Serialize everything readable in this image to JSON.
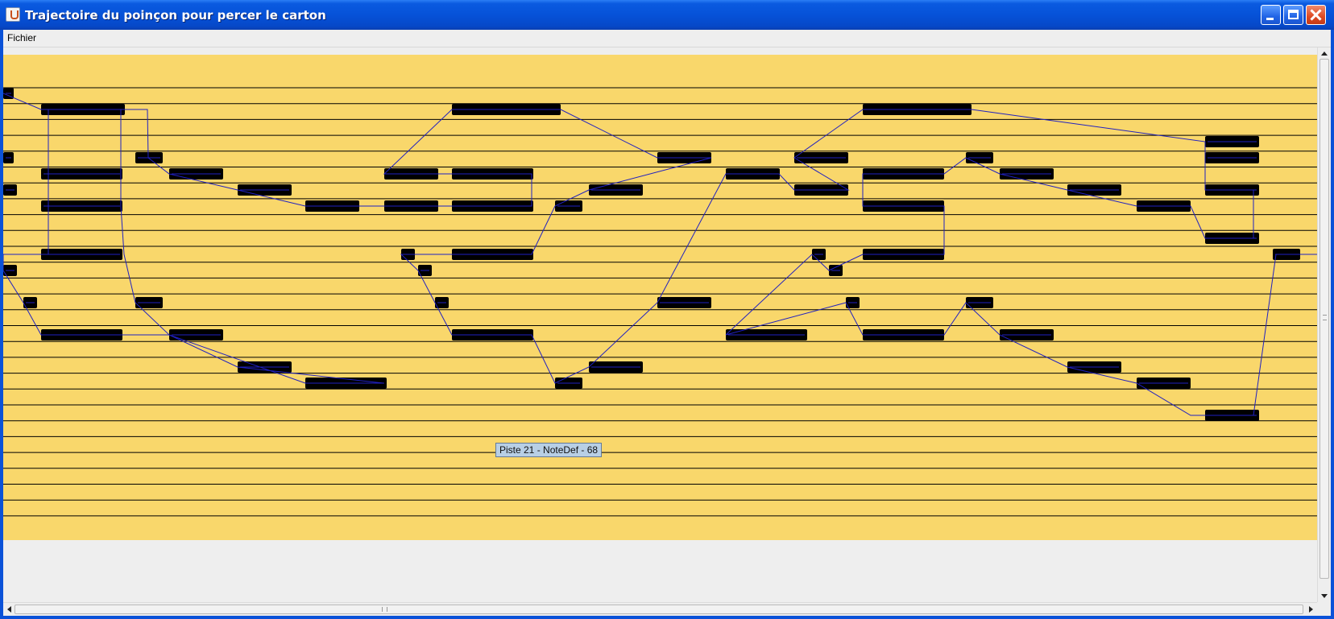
{
  "window": {
    "title": "Trajectoire du poinçon pour percer le carton",
    "buttons": [
      "minimize",
      "maximize",
      "close"
    ]
  },
  "menu": {
    "items": [
      "Fichier"
    ]
  },
  "board": {
    "background_color": "#f9d76b",
    "track_line_color": "#000000",
    "punch_color": "#000000",
    "path_color": "#2020c0"
  },
  "tooltip": {
    "text": "Piste 21 - NoteDef -  68"
  },
  "icons": {
    "app": "java-app-icon",
    "scroll_up": "up-arrow-icon",
    "scroll_down": "down-arrow-icon",
    "scroll_left": "left-arrow-icon",
    "scroll_right": "right-arrow-icon"
  }
}
